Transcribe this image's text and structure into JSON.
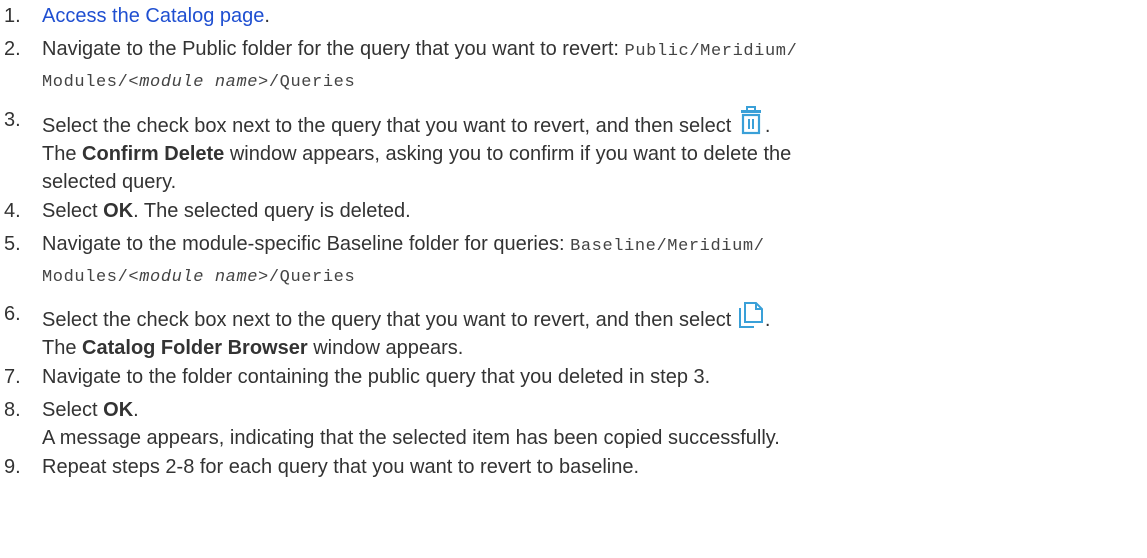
{
  "steps": [
    {
      "number": "1.",
      "link_text": "Access the Catalog page",
      "after_link": "."
    },
    {
      "number": "2.",
      "text": "Navigate to the Public folder for the query that you want to revert: ",
      "path_prefix": "Public/Meridium/",
      "path_line2_a": "Modules/",
      "path_placeholder": "<module name>",
      "path_line2_b": "/Queries"
    },
    {
      "number": "3.",
      "text": "Select the check box next to the query that you want to revert, and then select ",
      "icon": "trash-icon",
      "after_icon": ".",
      "line2_a": "The ",
      "line2_bold": "Confirm Delete",
      "line2_b": " window appears, asking you to confirm if you want to delete the",
      "line3": "selected query."
    },
    {
      "number": "4.",
      "text_a": "Select ",
      "bold": "OK",
      "text_b": ". The selected query is deleted."
    },
    {
      "number": "5.",
      "text": "Navigate to the module-specific Baseline folder for queries: ",
      "path_prefix": "Baseline/Meridium/",
      "path_line2_a": "Modules/",
      "path_placeholder": "<module name>",
      "path_line2_b": "/Queries"
    },
    {
      "number": "6.",
      "text": "Select the check box next to the query that you want to revert, and then select ",
      "icon": "copy-icon",
      "after_icon": ".",
      "line2_a": "The ",
      "line2_bold": "Catalog Folder Browser",
      "line2_b": " window appears."
    },
    {
      "number": "7.",
      "text": "Navigate to the folder containing the public query that you deleted in step 3."
    },
    {
      "number": "8.",
      "text_a": "Select ",
      "bold": "OK",
      "text_b": ".",
      "line2": "A message appears, indicating that the selected item has been copied successfully."
    },
    {
      "number": "9.",
      "text": "Repeat steps 2-8 for each query that you want to revert to baseline."
    }
  ],
  "colors": {
    "text": "#333333",
    "link": "#1f4fd1",
    "icon": "#3aa0d8"
  }
}
